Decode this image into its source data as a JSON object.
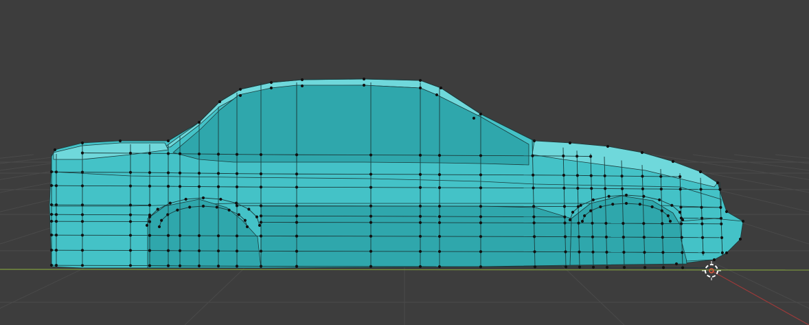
{
  "viewport": {
    "background_color": "#3d3d3d",
    "grid_color": "#4a4a4a",
    "x_axis_color": "#7f9c3e",
    "y_axis_color": "#9c3a3a",
    "mesh": {
      "object_type": "car-body",
      "face_color": "#44c2c7",
      "face_shade_color": "#2fa7ac",
      "face_highlight_color": "#6fd8db",
      "edge_color": "#1b3a3b",
      "vertex_color": "#111111"
    },
    "cursor_3d": {
      "icon": "3d-cursor-icon",
      "ring_color": "#ffffff",
      "accent_color": "#e05a3a"
    }
  }
}
